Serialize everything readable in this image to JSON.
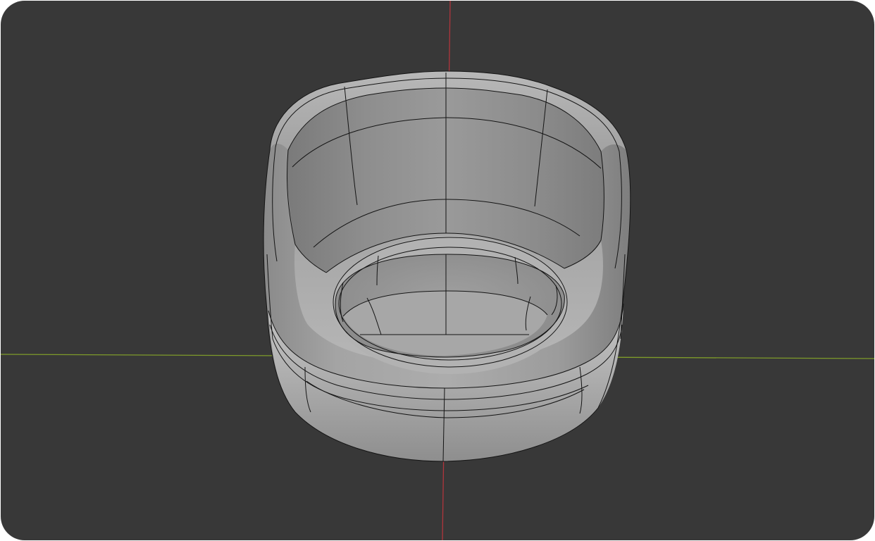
{
  "app": {
    "name": "",
    "editor": "3D Viewport"
  },
  "viewport": {
    "background_color": "#383838",
    "axes": {
      "x_axis_color": "#7e9b2a",
      "y_axis_color": "#b0353c"
    },
    "object": {
      "type": "mesh",
      "shading": "solid",
      "overlay": "wireframe",
      "surface_color": "#9c9c9c",
      "wire_color": "#141414",
      "description_icon": "tub-chair-mesh"
    }
  }
}
